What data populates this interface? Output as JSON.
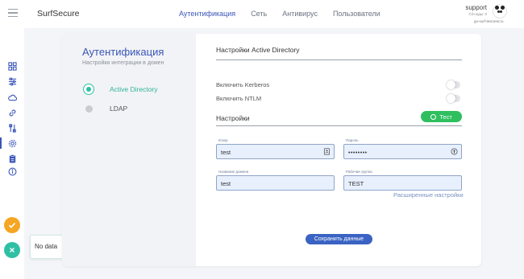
{
  "app": {
    "brand": "SurfSecure"
  },
  "topnav": {
    "items": [
      {
        "label": "Аутентификация",
        "active": true
      },
      {
        "label": "Сеть",
        "active": false
      },
      {
        "label": "Антивирус",
        "active": false
      },
      {
        "label": "Пользователи",
        "active": false
      }
    ]
  },
  "user": {
    "name": "support",
    "sub": "Сlі-ноды: 0",
    "host": "go-surf-test.test.ru"
  },
  "sidebar": {
    "icons": [
      "dashboard-icon",
      "sliders-icon",
      "cloud-icon",
      "link-icon",
      "tools-icon",
      "gear-icon",
      "clipboard-icon",
      "info-icon"
    ],
    "active": "gear-icon"
  },
  "status": {
    "nodata_label": "No data"
  },
  "auth": {
    "title": "Аутентификация",
    "subtitle": "Настройки интеграции в домен",
    "options": [
      {
        "label": "Active Directory",
        "selected": true
      },
      {
        "label": "LDAP",
        "selected": false
      }
    ]
  },
  "ad": {
    "section_title": "Настройки Active Directory",
    "toggles": [
      {
        "label": "Включить Kerberos",
        "on": false
      },
      {
        "label": "Включить NTLM",
        "on": false
      }
    ],
    "settings_title": "Настройки",
    "test_button": "Тест",
    "fields": {
      "user": {
        "label": "Юзер",
        "value": "test"
      },
      "password": {
        "label": "Пароль",
        "value": "••••••••"
      },
      "domain": {
        "label": "Название домена",
        "value": "test"
      },
      "workgroup": {
        "label": "Рабочая группа",
        "value": "TEST"
      }
    },
    "advanced_link": "Расширенные настройки",
    "save_button": "Сохранить данные"
  },
  "colors": {
    "accent": "#3a56b8",
    "teal": "#2fc0a4",
    "green": "#2fbf5f",
    "orange": "#f5a623"
  }
}
